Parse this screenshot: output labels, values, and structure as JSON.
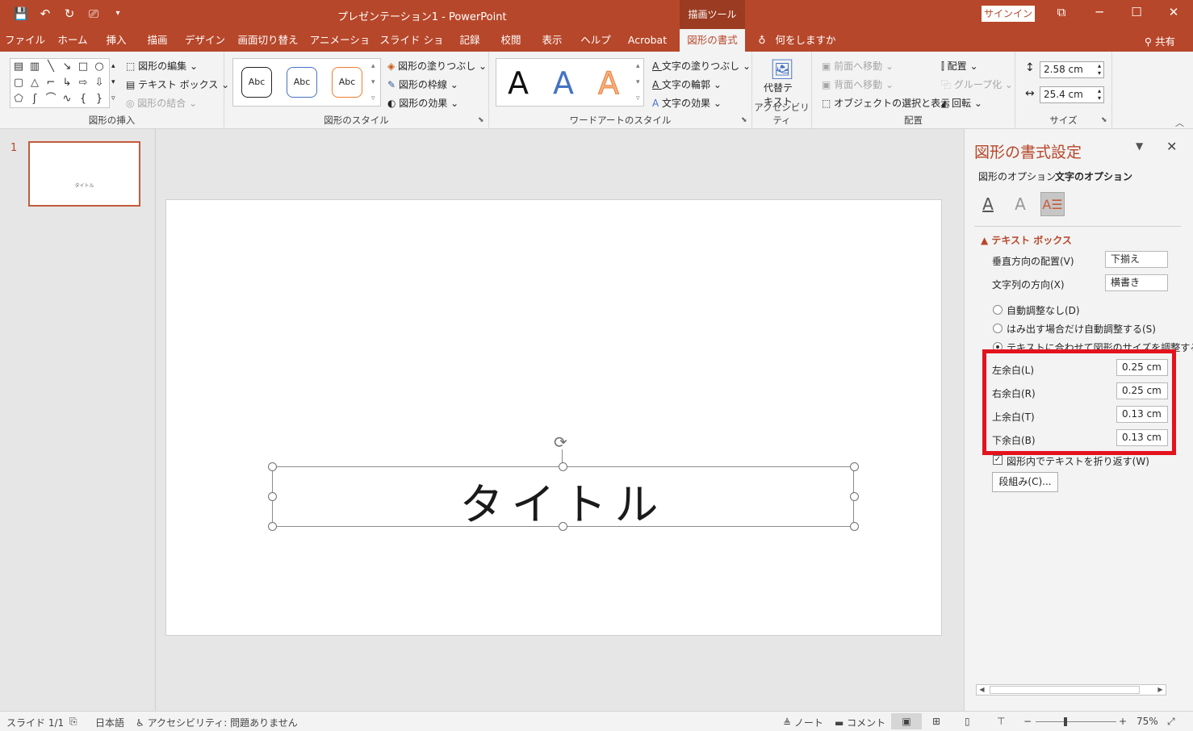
{
  "titlebar": {
    "title": "プレゼンテーション1  -  PowerPoint",
    "context_tab": "描画ツール",
    "signin": "サインイン",
    "qat": [
      "💾",
      "↶",
      "↻",
      "⎚",
      "▾"
    ]
  },
  "tabs": [
    "ファイル",
    "ホーム",
    "挿入",
    "描画",
    "デザイン",
    "画面切り替え",
    "アニメーション",
    "スライド ショー",
    "記録",
    "校閲",
    "表示",
    "ヘルプ",
    "Acrobat",
    "図形の書式",
    "何をしますか"
  ],
  "share": "共有",
  "ribbon": {
    "insert_shapes": {
      "label": "図形の挿入",
      "edit_shape": "図形の編集",
      "text_box": "テキスト ボックス",
      "merge_shapes": "図形の結合"
    },
    "shape_styles": {
      "label": "図形のスタイル",
      "abc": "Abc",
      "fill": "図形の塗りつぶし",
      "outline": "図形の枠線",
      "effects": "図形の効果"
    },
    "wordart": {
      "label": "ワードアートのスタイル",
      "letter": "A",
      "text_fill": "文字の塗りつぶし",
      "text_outline": "文字の輪郭",
      "text_effects": "文字の効果"
    },
    "accessibility": {
      "label": "アクセシビリティ",
      "alt_text_1": "代替テ",
      "alt_text_2": "キスト"
    },
    "arrange": {
      "label": "配置",
      "bring_forward": "前面へ移動",
      "send_backward": "背面へ移動",
      "selection_pane": "オブジェクトの選択と表示",
      "align": "配置",
      "group": "グループ化",
      "rotate": "回転"
    },
    "size": {
      "label": "サイズ",
      "height": "2.58 cm",
      "width": "25.4 cm"
    }
  },
  "slides": {
    "number": "1",
    "thumb_text": "タイトル"
  },
  "slide": {
    "title_text": "タイトル"
  },
  "format_pane": {
    "title": "図形の書式設定",
    "shape_options": "図形のオプション",
    "text_options": "文字のオプション",
    "section": "テキスト ボックス",
    "vertical_alignment_label": "垂直方向の配置(V)",
    "vertical_alignment_value": "下揃え",
    "text_direction_label": "文字列の方向(X)",
    "text_direction_value": "横書き",
    "autofit": [
      {
        "label": "自動調整なし(D)",
        "selected": false
      },
      {
        "label": "はみ出す場合だけ自動調整する(S)",
        "selected": false
      },
      {
        "label": "テキストに合わせて図形のサイズを調整する",
        "selected": true
      }
    ],
    "margins": [
      {
        "label": "左余白(L)",
        "value": "0.25 cm"
      },
      {
        "label": "右余白(R)",
        "value": "0.25 cm"
      },
      {
        "label": "上余白(T)",
        "value": "0.13 cm"
      },
      {
        "label": "下余白(B)",
        "value": "0.13 cm"
      }
    ],
    "wrap_text": "図形内でテキストを折り返す(W)",
    "columns_button": "段組み(C)..."
  },
  "status": {
    "slide": "スライド 1/1",
    "language": "日本語",
    "accessibility": "アクセシビリティ: 問題ありません",
    "notes": "ノート",
    "comments": "コメント",
    "zoom": "75%"
  },
  "colors": {
    "accent": "#b7472a",
    "highlight_box": "#e3131e"
  }
}
